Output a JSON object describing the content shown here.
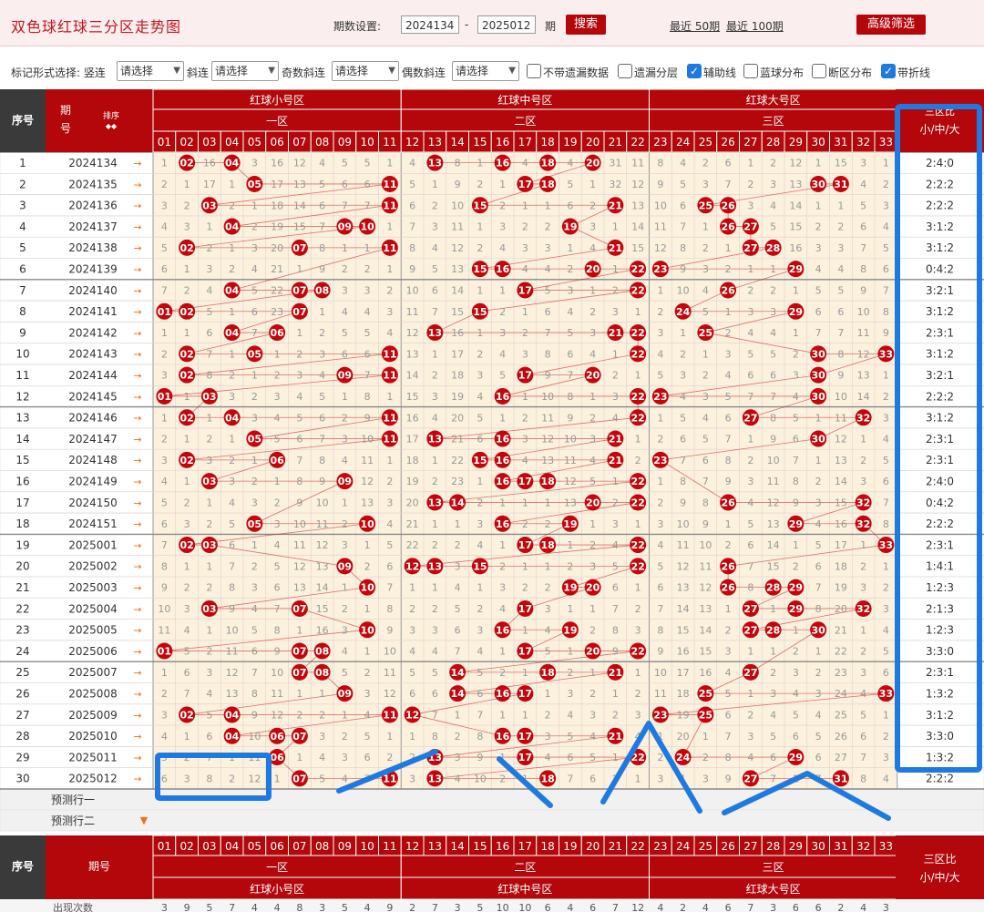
{
  "header": {
    "title": "双色球红球三分区走势图",
    "period_label": "期数设置:",
    "period_from": "2024134",
    "period_to": "2025012",
    "period_unit": "期",
    "search_label": "搜索",
    "recent50": "最近 50期",
    "recent100": "最近 100期",
    "advanced_label": "高级筛选"
  },
  "options": {
    "mark_label": "标记形式选择: 竖连",
    "select_placeholder": "请选择",
    "diag_label": "斜连",
    "odd_diag_label": "奇数斜连",
    "even_diag_label": "偶数斜连",
    "checkboxes": [
      {
        "label": "不带遗漏数据",
        "checked": false
      },
      {
        "label": "遗漏分层",
        "checked": false
      },
      {
        "label": "辅助线",
        "checked": true
      },
      {
        "label": "蓝球分布",
        "checked": false
      },
      {
        "label": "断区分布",
        "checked": false
      },
      {
        "label": "带折线",
        "checked": true
      }
    ]
  },
  "table_header": {
    "seq": "序号",
    "issue": "期号",
    "sort": "排序",
    "zone_names": [
      "红球小号区",
      "红球中号区",
      "红球大号区"
    ],
    "zone_short": [
      "一区",
      "二区",
      "三区"
    ],
    "ratio_title": "三区比",
    "ratio_sub": "小/中/大",
    "numbers": [
      "01",
      "02",
      "03",
      "04",
      "05",
      "06",
      "07",
      "08",
      "09",
      "10",
      "11",
      "12",
      "13",
      "14",
      "15",
      "16",
      "17",
      "18",
      "19",
      "20",
      "21",
      "22",
      "23",
      "24",
      "25",
      "26",
      "27",
      "28",
      "29",
      "30",
      "31",
      "32",
      "33"
    ]
  },
  "rows": [
    {
      "seq": "1",
      "issue": "2024134",
      "ratio": "2:4:0",
      "cells": [
        1,
        "02",
        16,
        "04",
        3,
        16,
        12,
        4,
        5,
        5,
        1,
        4,
        "13",
        8,
        1,
        "16",
        4,
        "18",
        4,
        "20",
        31,
        11,
        8,
        4,
        2,
        6,
        1,
        2,
        12,
        1,
        15,
        3,
        1
      ]
    },
    {
      "seq": "2",
      "issue": "2024135",
      "ratio": "2:2:2",
      "cells": [
        2,
        1,
        17,
        1,
        "05",
        17,
        13,
        5,
        6,
        6,
        "11",
        5,
        1,
        9,
        2,
        1,
        "17",
        "18",
        5,
        1,
        32,
        12,
        9,
        5,
        3,
        7,
        2,
        3,
        13,
        "30",
        "31",
        4,
        2
      ]
    },
    {
      "seq": "3",
      "issue": "2024136",
      "ratio": "2:2:2",
      "cells": [
        3,
        2,
        "03",
        2,
        1,
        18,
        14,
        6,
        7,
        7,
        "11",
        6,
        2,
        10,
        "15",
        2,
        1,
        1,
        6,
        2,
        "21",
        13,
        10,
        6,
        "25",
        "26",
        3,
        4,
        14,
        1,
        1,
        5,
        3
      ]
    },
    {
      "seq": "4",
      "issue": "2024137",
      "ratio": "3:1:2",
      "cells": [
        4,
        3,
        1,
        "04",
        2,
        19,
        15,
        7,
        "09",
        "10",
        1,
        7,
        3,
        11,
        1,
        3,
        2,
        2,
        "19",
        3,
        1,
        14,
        11,
        7,
        1,
        "26",
        "27",
        5,
        15,
        2,
        2,
        6,
        4
      ]
    },
    {
      "seq": "5",
      "issue": "2024138",
      "ratio": "3:1:2",
      "cells": [
        5,
        "02",
        2,
        1,
        3,
        20,
        "07",
        8,
        1,
        1,
        "11",
        8,
        4,
        12,
        2,
        4,
        3,
        3,
        1,
        4,
        "21",
        15,
        12,
        8,
        2,
        1,
        "27",
        "28",
        16,
        3,
        3,
        7,
        5
      ]
    },
    {
      "seq": "6",
      "issue": "2024139",
      "ratio": "0:4:2",
      "cells": [
        6,
        1,
        3,
        2,
        4,
        21,
        1,
        9,
        2,
        2,
        1,
        9,
        5,
        13,
        "15",
        "16",
        4,
        4,
        2,
        "20",
        1,
        "22",
        "23",
        9,
        3,
        2,
        1,
        1,
        "29",
        4,
        4,
        8,
        6
      ]
    },
    {
      "seq": "7",
      "issue": "2024140",
      "ratio": "3:2:1",
      "cells": [
        7,
        2,
        4,
        "04",
        5,
        22,
        "07",
        "08",
        3,
        3,
        2,
        10,
        6,
        14,
        1,
        1,
        "17",
        5,
        3,
        1,
        2,
        "22",
        1,
        10,
        4,
        "26",
        2,
        2,
        1,
        5,
        5,
        9,
        7
      ]
    },
    {
      "seq": "8",
      "issue": "2024141",
      "ratio": "3:1:2",
      "cells": [
        "01",
        "02",
        5,
        1,
        6,
        23,
        "07",
        1,
        4,
        4,
        3,
        11,
        7,
        15,
        "15",
        2,
        1,
        6,
        4,
        2,
        3,
        1,
        2,
        "24",
        5,
        1,
        3,
        3,
        "29",
        6,
        6,
        10,
        8
      ]
    },
    {
      "seq": "9",
      "issue": "2024142",
      "ratio": "2:3:1",
      "cells": [
        1,
        1,
        6,
        "04",
        7,
        "06",
        1,
        2,
        5,
        5,
        4,
        12,
        "13",
        16,
        1,
        3,
        2,
        7,
        5,
        3,
        "21",
        "22",
        3,
        1,
        "25",
        2,
        4,
        4,
        1,
        7,
        7,
        11,
        9
      ]
    },
    {
      "seq": "10",
      "issue": "2024143",
      "ratio": "3:1:2",
      "cells": [
        2,
        "02",
        7,
        1,
        "05",
        1,
        2,
        3,
        6,
        6,
        "11",
        13,
        1,
        17,
        2,
        4,
        3,
        8,
        6,
        4,
        1,
        "22",
        4,
        2,
        1,
        3,
        5,
        5,
        2,
        "30",
        8,
        12,
        "33"
      ]
    },
    {
      "seq": "11",
      "issue": "2024144",
      "ratio": "3:2:1",
      "cells": [
        3,
        "02",
        8,
        2,
        1,
        2,
        3,
        4,
        "09",
        7,
        "11",
        14,
        2,
        18,
        3,
        5,
        "17",
        9,
        7,
        "20",
        2,
        1,
        5,
        3,
        2,
        4,
        6,
        6,
        3,
        "30",
        9,
        13,
        1
      ]
    },
    {
      "seq": "12",
      "issue": "2024145",
      "ratio": "2:2:2",
      "cells": [
        "01",
        1,
        "03",
        3,
        2,
        3,
        4,
        5,
        1,
        8,
        1,
        15,
        3,
        19,
        4,
        "16",
        1,
        10,
        8,
        1,
        3,
        "22",
        "23",
        4,
        3,
        5,
        7,
        7,
        4,
        "30",
        10,
        14,
        2
      ]
    },
    {
      "seq": "13",
      "issue": "2024146",
      "ratio": "3:1:2",
      "cells": [
        1,
        "02",
        1,
        "04",
        3,
        4,
        5,
        6,
        2,
        9,
        "11",
        16,
        4,
        20,
        5,
        1,
        2,
        11,
        9,
        2,
        4,
        "22",
        1,
        5,
        4,
        6,
        "27",
        8,
        5,
        1,
        11,
        "32",
        3
      ]
    },
    {
      "seq": "14",
      "issue": "2024147",
      "ratio": "2:3:1",
      "cells": [
        2,
        1,
        2,
        1,
        "05",
        5,
        6,
        7,
        3,
        10,
        "11",
        17,
        "13",
        21,
        6,
        "16",
        3,
        12,
        10,
        3,
        "21",
        1,
        2,
        6,
        5,
        7,
        1,
        9,
        6,
        "30",
        12,
        1,
        4
      ]
    },
    {
      "seq": "15",
      "issue": "2024148",
      "ratio": "2:3:1",
      "cells": [
        3,
        "02",
        3,
        2,
        1,
        "06",
        7,
        8,
        4,
        11,
        1,
        18,
        1,
        22,
        "15",
        "16",
        4,
        13,
        11,
        4,
        "21",
        2,
        "23",
        7,
        6,
        8,
        2,
        10,
        7,
        1,
        13,
        2,
        5
      ]
    },
    {
      "seq": "16",
      "issue": "2024149",
      "ratio": "2:4:0",
      "cells": [
        4,
        1,
        "03",
        3,
        2,
        1,
        8,
        9,
        "09",
        12,
        2,
        19,
        2,
        23,
        1,
        "16",
        "17",
        "18",
        12,
        5,
        1,
        "22",
        1,
        8,
        7,
        9,
        3,
        11,
        8,
        2,
        14,
        3,
        6
      ]
    },
    {
      "seq": "17",
      "issue": "2024150",
      "ratio": "0:4:2",
      "cells": [
        5,
        2,
        1,
        4,
        3,
        2,
        9,
        10,
        1,
        13,
        3,
        20,
        "13",
        "14",
        2,
        1,
        1,
        1,
        13,
        "20",
        2,
        "22",
        2,
        9,
        8,
        "26",
        4,
        12,
        9,
        3,
        15,
        "32",
        7
      ]
    },
    {
      "seq": "18",
      "issue": "2024151",
      "ratio": "2:2:2",
      "cells": [
        6,
        3,
        2,
        5,
        "05",
        3,
        10,
        11,
        2,
        "10",
        4,
        21,
        1,
        1,
        3,
        "16",
        2,
        2,
        "19",
        1,
        3,
        1,
        3,
        10,
        9,
        1,
        5,
        13,
        "29",
        4,
        16,
        "32",
        8
      ]
    },
    {
      "seq": "19",
      "issue": "2025001",
      "ratio": "2:3:1",
      "cells": [
        7,
        "02",
        "03",
        6,
        1,
        4,
        11,
        12,
        3,
        1,
        5,
        22,
        2,
        2,
        4,
        1,
        "17",
        "18",
        1,
        2,
        4,
        "22",
        4,
        11,
        10,
        2,
        6,
        14,
        1,
        5,
        17,
        1,
        "33"
      ]
    },
    {
      "seq": "20",
      "issue": "2025002",
      "ratio": "1:4:1",
      "cells": [
        8,
        1,
        1,
        7,
        2,
        5,
        12,
        13,
        "09",
        2,
        6,
        "12",
        "13",
        3,
        "15",
        2,
        1,
        1,
        2,
        3,
        5,
        "22",
        5,
        12,
        11,
        "26",
        7,
        15,
        2,
        6,
        18,
        2,
        1
      ]
    },
    {
      "seq": "21",
      "issue": "2025003",
      "ratio": "1:2:3",
      "cells": [
        9,
        2,
        2,
        8,
        3,
        6,
        13,
        14,
        1,
        "10",
        7,
        1,
        1,
        4,
        1,
        3,
        2,
        2,
        "19",
        "20",
        6,
        1,
        6,
        13,
        12,
        "26",
        8,
        "28",
        "29",
        7,
        19,
        3,
        2
      ]
    },
    {
      "seq": "22",
      "issue": "2025004",
      "ratio": "2:1:3",
      "cells": [
        10,
        3,
        "03",
        9,
        4,
        7,
        "07",
        15,
        2,
        1,
        8,
        2,
        2,
        5,
        2,
        4,
        "17",
        3,
        1,
        1,
        7,
        2,
        7,
        14,
        13,
        1,
        "27",
        1,
        "29",
        8,
        20,
        "32",
        3
      ]
    },
    {
      "seq": "23",
      "issue": "2025005",
      "ratio": "1:2:3",
      "cells": [
        11,
        4,
        1,
        10,
        5,
        8,
        1,
        16,
        3,
        "10",
        9,
        3,
        3,
        6,
        3,
        "16",
        1,
        4,
        "19",
        2,
        8,
        3,
        8,
        15,
        14,
        2,
        "27",
        "28",
        1,
        "30",
        21,
        1,
        4
      ]
    },
    {
      "seq": "24",
      "issue": "2025006",
      "ratio": "3:3:0",
      "cells": [
        "01",
        5,
        2,
        11,
        6,
        9,
        "07",
        "08",
        4,
        1,
        10,
        4,
        4,
        7,
        4,
        1,
        "17",
        5,
        1,
        "20",
        9,
        "22",
        9,
        16,
        15,
        3,
        1,
        1,
        2,
        1,
        22,
        2,
        5
      ]
    },
    {
      "seq": "25",
      "issue": "2025007",
      "ratio": "2:3:1",
      "cells": [
        1,
        6,
        3,
        12,
        7,
        10,
        "07",
        "08",
        5,
        2,
        11,
        5,
        5,
        "14",
        5,
        2,
        1,
        "18",
        2,
        1,
        "21",
        1,
        10,
        17,
        16,
        4,
        "27",
        2,
        3,
        2,
        23,
        3,
        6
      ]
    },
    {
      "seq": "26",
      "issue": "2025008",
      "ratio": "1:3:2",
      "cells": [
        2,
        7,
        4,
        13,
        8,
        11,
        1,
        1,
        "09",
        3,
        12,
        6,
        6,
        "14",
        6,
        "16",
        "17",
        1,
        3,
        2,
        1,
        2,
        11,
        18,
        "25",
        5,
        1,
        3,
        4,
        3,
        24,
        4,
        "33"
      ]
    },
    {
      "seq": "27",
      "issue": "2025009",
      "ratio": "3:1:2",
      "cells": [
        3,
        "02",
        5,
        "04",
        9,
        12,
        2,
        2,
        1,
        4,
        "11",
        "12",
        7,
        1,
        7,
        1,
        1,
        2,
        4,
        3,
        2,
        3,
        "23",
        19,
        "25",
        6,
        2,
        4,
        5,
        4,
        25,
        5,
        1
      ]
    },
    {
      "seq": "28",
      "issue": "2025010",
      "ratio": "3:3:0",
      "cells": [
        4,
        1,
        6,
        "04",
        10,
        "06",
        "07",
        3,
        2,
        5,
        1,
        1,
        8,
        2,
        8,
        "16",
        "17",
        3,
        5,
        4,
        "21",
        4,
        1,
        20,
        1,
        7,
        3,
        5,
        6,
        5,
        26,
        6,
        2
      ]
    },
    {
      "seq": "29",
      "issue": "2025011",
      "ratio": "1:3:2",
      "cells": [
        5,
        2,
        7,
        1,
        11,
        "06",
        1,
        4,
        3,
        6,
        2,
        2,
        "13",
        3,
        9,
        1,
        "17",
        4,
        6,
        5,
        1,
        "22",
        2,
        "24",
        2,
        8,
        4,
        6,
        "29",
        6,
        27,
        7,
        3
      ]
    },
    {
      "seq": "30",
      "issue": "2025012",
      "ratio": "2:2:2",
      "cells": [
        6,
        3,
        8,
        2,
        12,
        1,
        "07",
        5,
        4,
        7,
        "11",
        3,
        "13",
        4,
        10,
        2,
        1,
        "18",
        7,
        6,
        2,
        1,
        3,
        1,
        3,
        9,
        "27",
        7,
        1,
        7,
        "31",
        8,
        4
      ]
    }
  ],
  "predict_rows": [
    "预测行一",
    "预测行二"
  ],
  "footer": {
    "occurrence_label": "出现次数",
    "occurrences": [
      "3",
      "9",
      "5",
      "7",
      "4",
      "4",
      "8",
      "3",
      "5",
      "4",
      "9",
      "2",
      "7",
      "3",
      "5",
      "10",
      "10",
      "6",
      "4",
      "6",
      "7",
      "12",
      "4",
      "2",
      "4",
      "6",
      "7",
      "3",
      "6",
      "6",
      "2",
      "4",
      "3"
    ]
  },
  "colors": {
    "brand_red": "#b3070b",
    "ball_red": "#c4060c",
    "annotation_blue": "#1e7ae0",
    "zone_bg": "#fbf1dd"
  }
}
